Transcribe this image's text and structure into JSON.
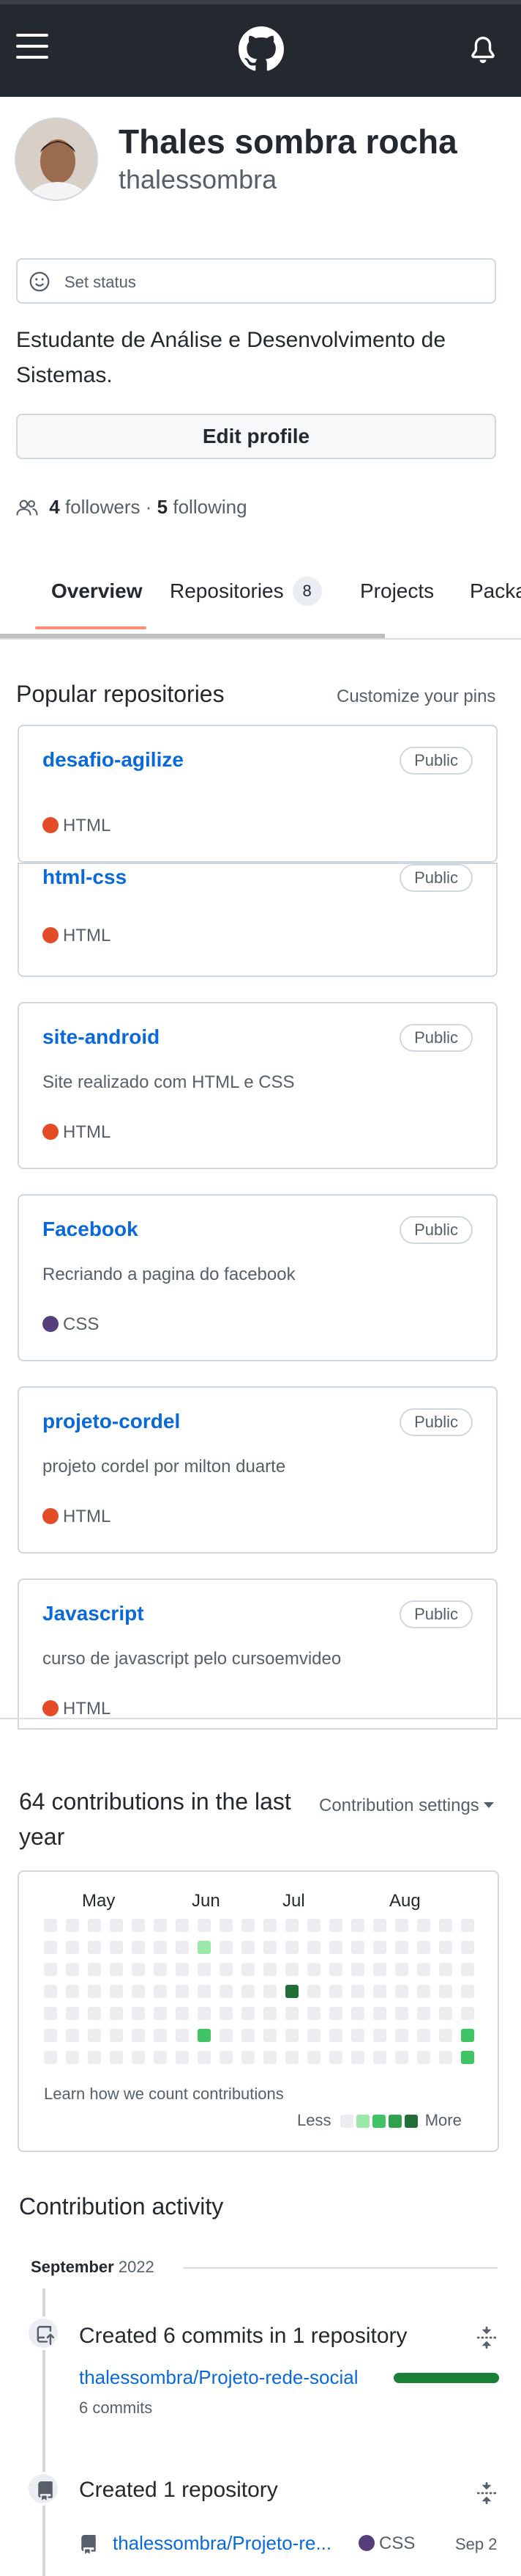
{
  "header": {
    "menu_icon": "hamburger-icon",
    "logo_icon": "github-mark-icon",
    "notification_icon": "bell-icon"
  },
  "profile": {
    "name": "Thales sombra rocha",
    "login": "thalessombra",
    "status_label": "Set status",
    "bio": "Estudante de Análise e Desenvolvimento de Sistemas.",
    "edit_button": "Edit profile",
    "followers_count": "4",
    "followers_label": "followers",
    "separator": "·",
    "following_count": "5",
    "following_label": "following"
  },
  "tabs": [
    {
      "label": "Overview",
      "active": true
    },
    {
      "label": "Repositories",
      "count": "8"
    },
    {
      "label": "Projects"
    },
    {
      "label": "Packages"
    }
  ],
  "popular": {
    "title": "Popular repositories",
    "customize_label": "Customize your pins",
    "repos": [
      {
        "name": "desafio-agilize",
        "visibility": "Public",
        "description": "",
        "language": "HTML",
        "lang_color": "#e34c26"
      },
      {
        "name": "html-css",
        "visibility": "Public",
        "description": "",
        "language": "HTML",
        "lang_color": "#e34c26"
      },
      {
        "name": "site-android",
        "visibility": "Public",
        "description": "Site realizado com HTML e CSS",
        "language": "HTML",
        "lang_color": "#e34c26"
      },
      {
        "name": "Facebook",
        "visibility": "Public",
        "description": "Recriando a pagina do facebook",
        "language": "CSS",
        "lang_color": "#563d7c"
      },
      {
        "name": "projeto-cordel",
        "visibility": "Public",
        "description": "projeto cordel por milton duarte",
        "language": "HTML",
        "lang_color": "#e34c26"
      },
      {
        "name": "Javascript",
        "visibility": "Public",
        "description": "curso de javascript pelo cursoemvideo",
        "language": "HTML",
        "lang_color": "#e34c26"
      }
    ]
  },
  "contributions": {
    "title": "64 contributions in the last year",
    "settings_label": "Contribution settings",
    "months": [
      "May",
      "Jun",
      "Jul",
      "Aug"
    ],
    "learn_label": "Learn how we count contributions",
    "legend_less": "Less",
    "legend_more": "More",
    "colors": {
      "empty": "#ebedf0",
      "l1": "#9be9a8",
      "l2": "#40c463",
      "l3": "#30a14e",
      "l4": "#216e39"
    }
  },
  "activity": {
    "title": "Contribution activity",
    "month_name": "September",
    "month_year": "2022",
    "items": [
      {
        "heading": "Created 6 commits in 1 repository",
        "repo": "thalessombra/Projeto-rede-social",
        "sub": "6 commits"
      },
      {
        "heading": "Created 1 repository",
        "repo": "thalessombra/Projeto-re...",
        "language": "CSS",
        "date": "Sep 2"
      }
    ]
  }
}
